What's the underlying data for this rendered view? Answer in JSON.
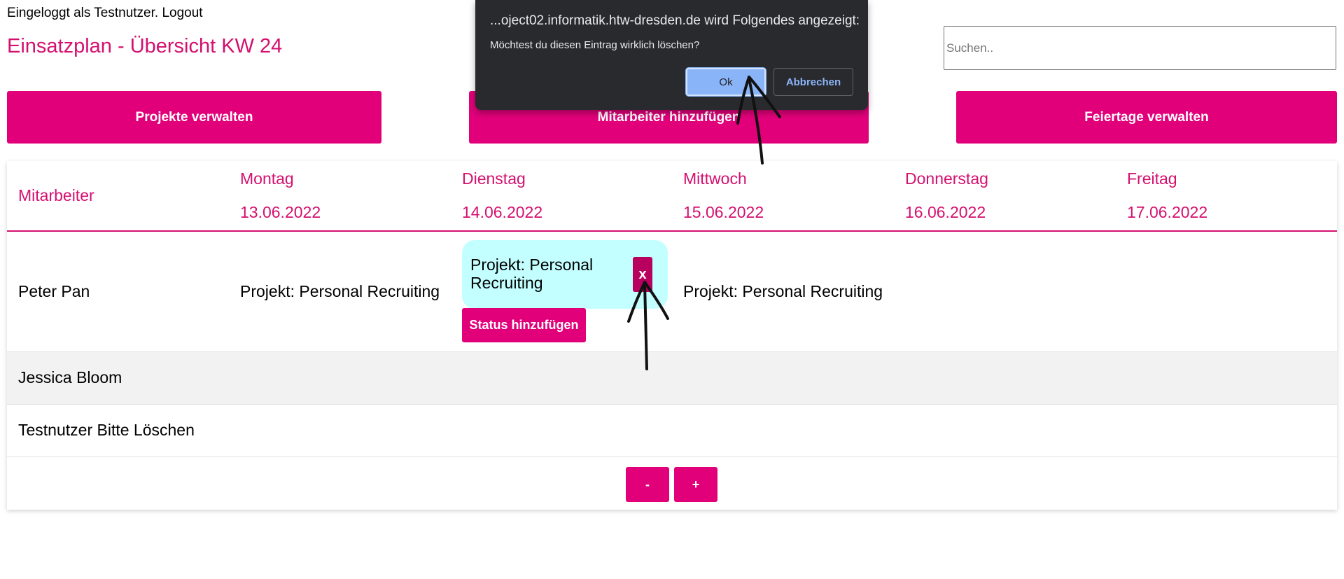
{
  "header": {
    "login_text": "Eingeloggt als Testnutzer. Logout",
    "page_title": "Einsatzplan - Übersicht KW 24",
    "search_placeholder": "Suchen.."
  },
  "nav": {
    "projects": "Projekte verwalten",
    "add_employee": "Mitarbeiter hinzufügen",
    "holidays": "Feiertage verwalten"
  },
  "table": {
    "employee_header": "Mitarbeiter",
    "days": [
      {
        "name": "Montag",
        "date": "13.06.2022"
      },
      {
        "name": "Dienstag",
        "date": "14.06.2022"
      },
      {
        "name": "Mittwoch",
        "date": "15.06.2022"
      },
      {
        "name": "Donnerstag",
        "date": "16.06.2022"
      },
      {
        "name": "Freitag",
        "date": "17.06.2022"
      }
    ],
    "rows": [
      {
        "name": "Peter Pan",
        "monday": "Projekt: Personal Recruiting",
        "tuesday": "Projekt: Personal Recruiting",
        "wednesday": "Projekt: Personal Recruiting"
      },
      {
        "name": "Jessica Bloom"
      },
      {
        "name": "Testnutzer Bitte Löschen"
      }
    ],
    "delete_label": "x",
    "status_label": "Status hinzufügen",
    "minus_label": "-",
    "plus_label": "+"
  },
  "dialog": {
    "title": "...oject02.informatik.htw-dresden.de wird Folgendes angezeigt:",
    "message": "Möchtest du diesen Eintrag wirklich löschen?",
    "ok_label": "Ok",
    "cancel_label": "Abbrechen"
  },
  "colors": {
    "accent": "#e2007a",
    "title": "#d4106f",
    "entry_bg": "#c4ffff",
    "dialog_bg": "#292a2d",
    "dialog_ok": "#8ab4f8"
  }
}
